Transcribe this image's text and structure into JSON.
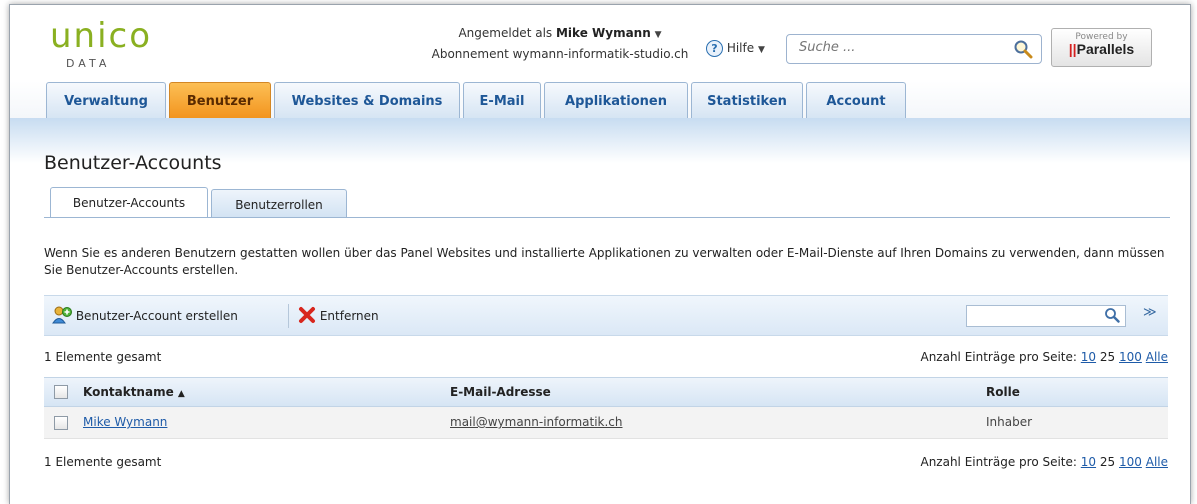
{
  "brand": {
    "logo_word": "unico",
    "logo_sub": "DATA",
    "powered_by": "Powered by",
    "vendor": "Parallels"
  },
  "header": {
    "logged_in_prefix": "Angemeldet als",
    "user_name": "Mike Wymann",
    "subscription": "Abonnement wymann-informatik-studio.ch",
    "help_label": "Hilfe",
    "search_placeholder": "Suche ..."
  },
  "nav": {
    "tabs": [
      {
        "label": "Verwaltung"
      },
      {
        "label": "Benutzer"
      },
      {
        "label": "Websites & Domains"
      },
      {
        "label": "E-Mail"
      },
      {
        "label": "Applikationen"
      },
      {
        "label": "Statistiken"
      },
      {
        "label": "Account"
      }
    ],
    "active_index": 1
  },
  "page": {
    "title": "Benutzer-Accounts",
    "subtabs": [
      {
        "label": "Benutzer-Accounts"
      },
      {
        "label": "Benutzerrollen"
      }
    ],
    "description": "Wenn Sie es anderen Benutzern gestatten wollen über das Panel Websites und installierte Applikationen zu verwalten oder E-Mail-Dienste auf Ihren Domains zu verwenden, dann müssen Sie Benutzer-Accounts erstellen."
  },
  "toolbar": {
    "create_label": "Benutzer-Account erstellen",
    "remove_label": "Entfernen",
    "search_value": ""
  },
  "list": {
    "count_text": "1 Elemente gesamt",
    "per_page_label": "Anzahl Einträge pro Seite:",
    "per_page_options": [
      "10",
      "25",
      "100",
      "Alle"
    ],
    "columns": {
      "name": "Kontaktname",
      "email": "E-Mail-Adresse",
      "role": "Rolle"
    },
    "rows": [
      {
        "name": "Mike Wymann",
        "email": "mail@wymann-informatik.ch",
        "role": "Inhaber"
      }
    ]
  },
  "colors": {
    "accent_orange": "#f2931d",
    "tab_blue": "#1e5797",
    "logo_green": "#8ab021",
    "link_blue": "#1e5ba8"
  }
}
